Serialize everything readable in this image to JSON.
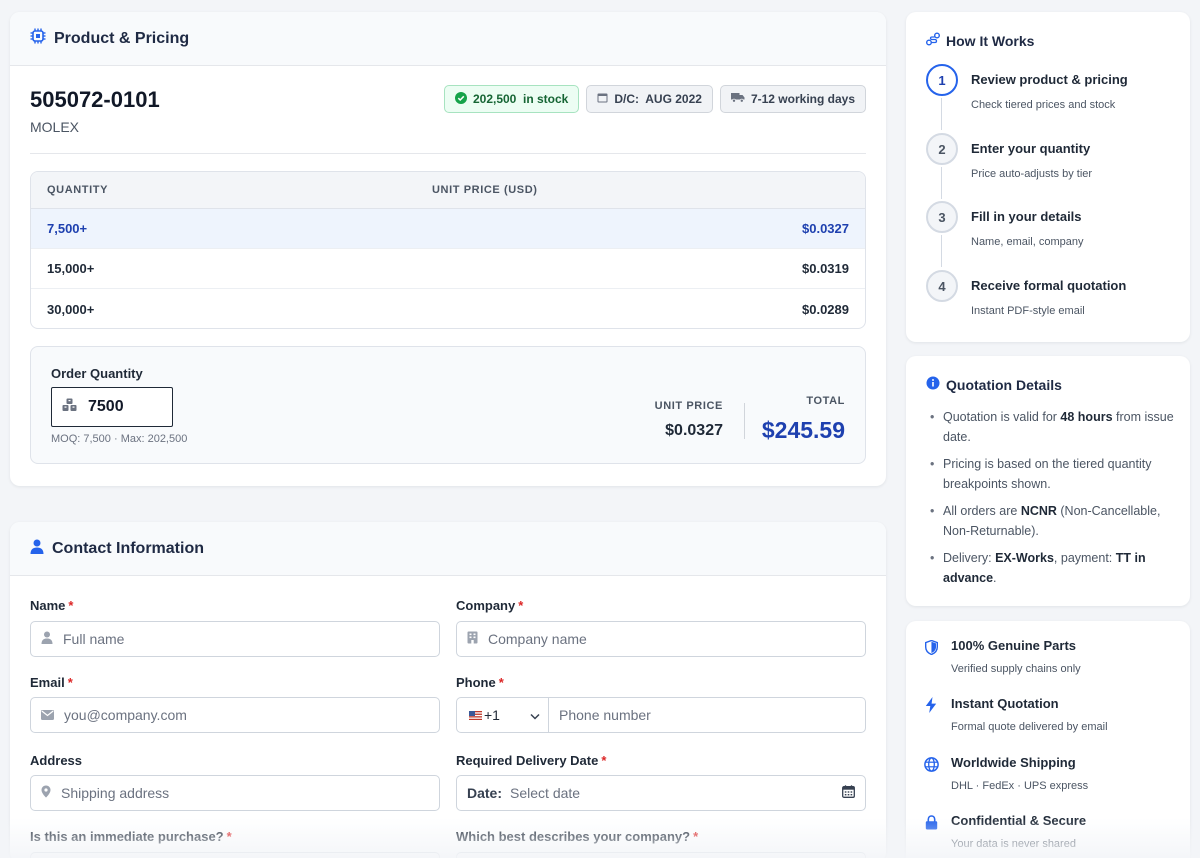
{
  "product": {
    "header_title": "Product & Pricing",
    "part_number": "505072-0101",
    "brand": "MOLEX",
    "badges": {
      "stock": "202,500  in stock",
      "date_code": "D/C:  AUG 2022",
      "lead_time": "7-12 working days"
    },
    "table": {
      "headers": [
        "QUANTITY",
        "UNIT PRICE (USD)"
      ],
      "rows": [
        {
          "qty": "7,500+",
          "price": "$0.0327",
          "active": true
        },
        {
          "qty": "15,000+",
          "price": "$0.0319",
          "active": false
        },
        {
          "qty": "30,000+",
          "price": "$0.0289",
          "active": false
        }
      ]
    },
    "order": {
      "label": "Order Quantity",
      "value": "7500",
      "hint": "MOQ: 7,500 · Max: 202,500",
      "unit_price_label": "UNIT PRICE",
      "unit_price_value": "$0.0327",
      "total_label": "TOTAL",
      "total_value": "$245.59"
    }
  },
  "contact": {
    "header_title": "Contact Information",
    "name": {
      "label": "Name",
      "placeholder": "Full name"
    },
    "company": {
      "label": "Company",
      "placeholder": "Company name"
    },
    "email": {
      "label": "Email",
      "placeholder": "you@company.com"
    },
    "phone": {
      "label": "Phone",
      "code": "+1",
      "placeholder": "Phone number"
    },
    "address": {
      "label": "Address",
      "placeholder": "Shipping address"
    },
    "delivery_date": {
      "label": "Required Delivery Date",
      "prefix": "Date:",
      "placeholder": "Select date"
    },
    "immediate": {
      "label": "Is this an immediate purchase?"
    },
    "company_type": {
      "label": "Which best describes your company?"
    },
    "required_mark": "*"
  },
  "how_it_works": {
    "title": "How It Works",
    "steps": [
      {
        "num": "1",
        "title": "Review product & pricing",
        "sub": "Check tiered prices and stock"
      },
      {
        "num": "2",
        "title": "Enter your quantity",
        "sub": "Price auto-adjusts by tier"
      },
      {
        "num": "3",
        "title": "Fill in your details",
        "sub": "Name, email, company"
      },
      {
        "num": "4",
        "title": "Receive formal quotation",
        "sub": "Instant PDF-style email"
      }
    ]
  },
  "quotation_details": {
    "title": "Quotation Details",
    "items": [
      {
        "pre": "Quotation is valid for ",
        "bold": "48 hours",
        "post": " from issue date."
      },
      {
        "pre": "Pricing is based on the tiered quantity breakpoints shown.",
        "bold": "",
        "post": ""
      },
      {
        "pre": "All orders are ",
        "bold": "NCNR",
        "post": " (Non-Cancellable, Non-Returnable)."
      },
      {
        "pre": "Delivery: ",
        "bold": "EX-Works",
        "post": ", payment: ",
        "bold2": "TT in advance",
        "post2": "."
      }
    ]
  },
  "trust": [
    {
      "icon": "shield-icon",
      "title": "100% Genuine Parts",
      "sub": "Verified supply chains only"
    },
    {
      "icon": "bolt-icon",
      "title": "Instant Quotation",
      "sub": "Formal quote delivered by email"
    },
    {
      "icon": "globe-icon",
      "title": "Worldwide Shipping",
      "sub": "DHL · FedEx · UPS express"
    },
    {
      "icon": "lock-icon",
      "title": "Confidential & Secure",
      "sub": "Your data is never shared"
    }
  ],
  "colors": {
    "accent": "#2563eb",
    "accent_dark": "#1e40af",
    "stock_green": "#16a34a",
    "required_red": "#dc2626"
  }
}
